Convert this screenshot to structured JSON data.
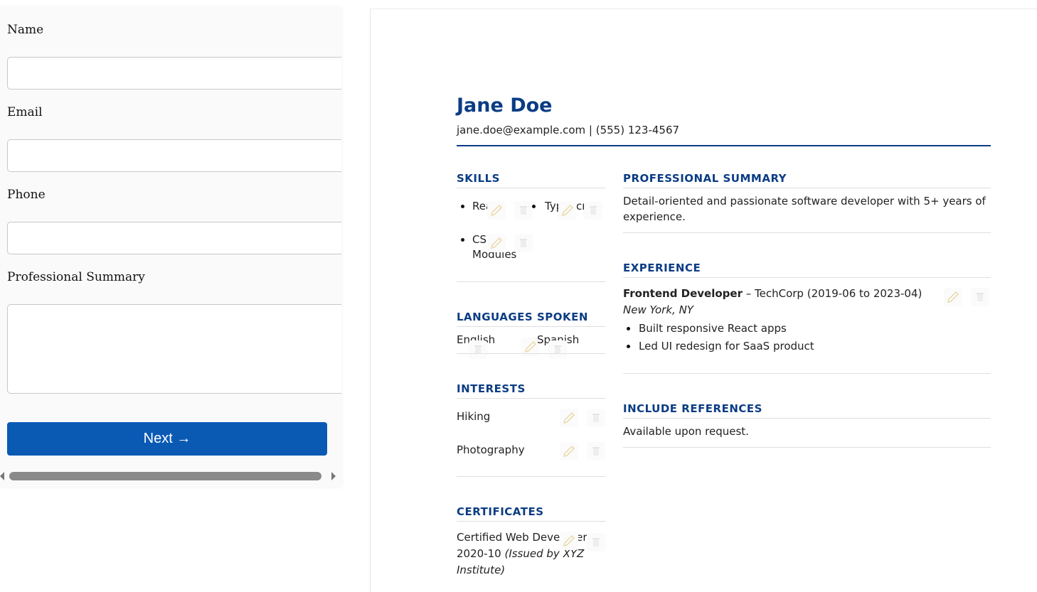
{
  "form": {
    "name_label": "Name",
    "name_value": "",
    "email_label": "Email",
    "email_value": "",
    "phone_label": "Phone",
    "phone_value": "",
    "summary_label": "Professional Summary",
    "summary_value": "",
    "next_label": "Next →"
  },
  "resume": {
    "name": "Jane Doe",
    "contact": "jane.doe@example.com | (555) 123-4567",
    "skills": {
      "title": "SKILLS",
      "items": [
        "React",
        "TypeScript",
        "CSS",
        "Modules"
      ]
    },
    "languages": {
      "title": "LANGUAGES SPOKEN",
      "items": [
        "English",
        "Spanish"
      ]
    },
    "interests": {
      "title": "INTERESTS",
      "items": [
        "Hiking",
        "Photography"
      ]
    },
    "certificates": {
      "title": "CERTIFICATES",
      "line1": "Certified Web Developer –",
      "line2_date": "2020-10",
      "line2_issuer": "(Issued by XYZ",
      "line3": "Institute)"
    },
    "summary": {
      "title": "PROFESSIONAL SUMMARY",
      "line1": "Detail-oriented and passionate software developer with 5+ years of",
      "line2": "experience."
    },
    "experience": {
      "title": "EXPERIENCE",
      "role": "Frontend Developer",
      "company_dates": " – TechCorp (2019-06 to 2023-04)",
      "location": "New York, NY",
      "bullets": [
        "Built responsive React apps",
        "Led UI redesign for SaaS product"
      ]
    },
    "references": {
      "title": "INCLUDE REFERENCES",
      "text": "Available upon request."
    }
  },
  "colors": {
    "accent": "#0b3c84",
    "button": "#0a5ab4"
  }
}
